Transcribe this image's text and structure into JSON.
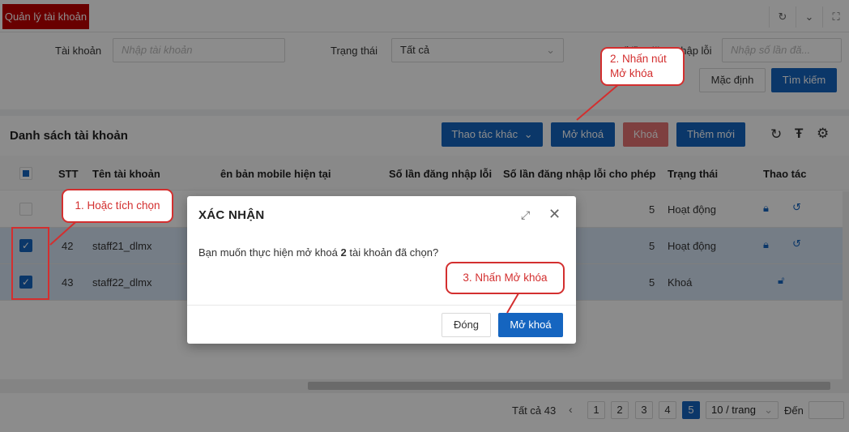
{
  "tabs": {
    "active": "Quản lý tài khoản"
  },
  "filters": {
    "account_label": "Tài khoản",
    "account_placeholder": "Nhập tài khoản",
    "status_label": "Trạng thái",
    "status_value": "Tất cả",
    "login_fail_label": "Số lần đăng nhập lỗi",
    "login_fail_placeholder": "Nhập số lần đă...",
    "reset_button": "Mặc định",
    "search_button": "Tìm kiếm"
  },
  "list": {
    "title": "Danh sách tài khoản",
    "other_actions": "Thao tác khác",
    "unlock_button": "Mở khoá",
    "lock_button": "Khoá",
    "add_button": "Thêm mới"
  },
  "table": {
    "headers": [
      "STT",
      "Tên tài khoản",
      "ên bản mobile hiện tại",
      "Số lần đăng nhập lỗi",
      "Số lần đăng nhập lỗi cho phép",
      "Trạng thái",
      "Thao tác"
    ],
    "rows": [
      {
        "stt": "",
        "name": "",
        "allowed": "5",
        "status": "Hoạt động"
      },
      {
        "stt": "42",
        "name": "staff21_dlmx",
        "allowed": "5",
        "status": "Hoạt động"
      },
      {
        "stt": "43",
        "name": "staff22_dlmx",
        "allowed": "5",
        "status": "Khoá"
      }
    ]
  },
  "modal": {
    "title": "XÁC NHẬN",
    "body_prefix": "Bạn muốn thực hiện mở khoá ",
    "body_count": "2",
    "body_suffix": " tài khoản đã chọn?",
    "close_button": "Đóng",
    "confirm_button": "Mở khoá"
  },
  "callouts": {
    "step1": "1. Hoặc tích chọn",
    "step2_line1": "2. Nhấn nút",
    "step2_line2": "Mở khóa",
    "step3": "3. Nhấn Mở khóa"
  },
  "pagination": {
    "total": "Tất cả 43",
    "pages": [
      "1",
      "2",
      "3",
      "4",
      "5"
    ],
    "active_page": "5",
    "page_size": "10 / trang",
    "goto_label": "Đến"
  },
  "colors": {
    "brand_red": "#c00000",
    "primary": "#1565c0",
    "annotation": "#d32f2f"
  }
}
